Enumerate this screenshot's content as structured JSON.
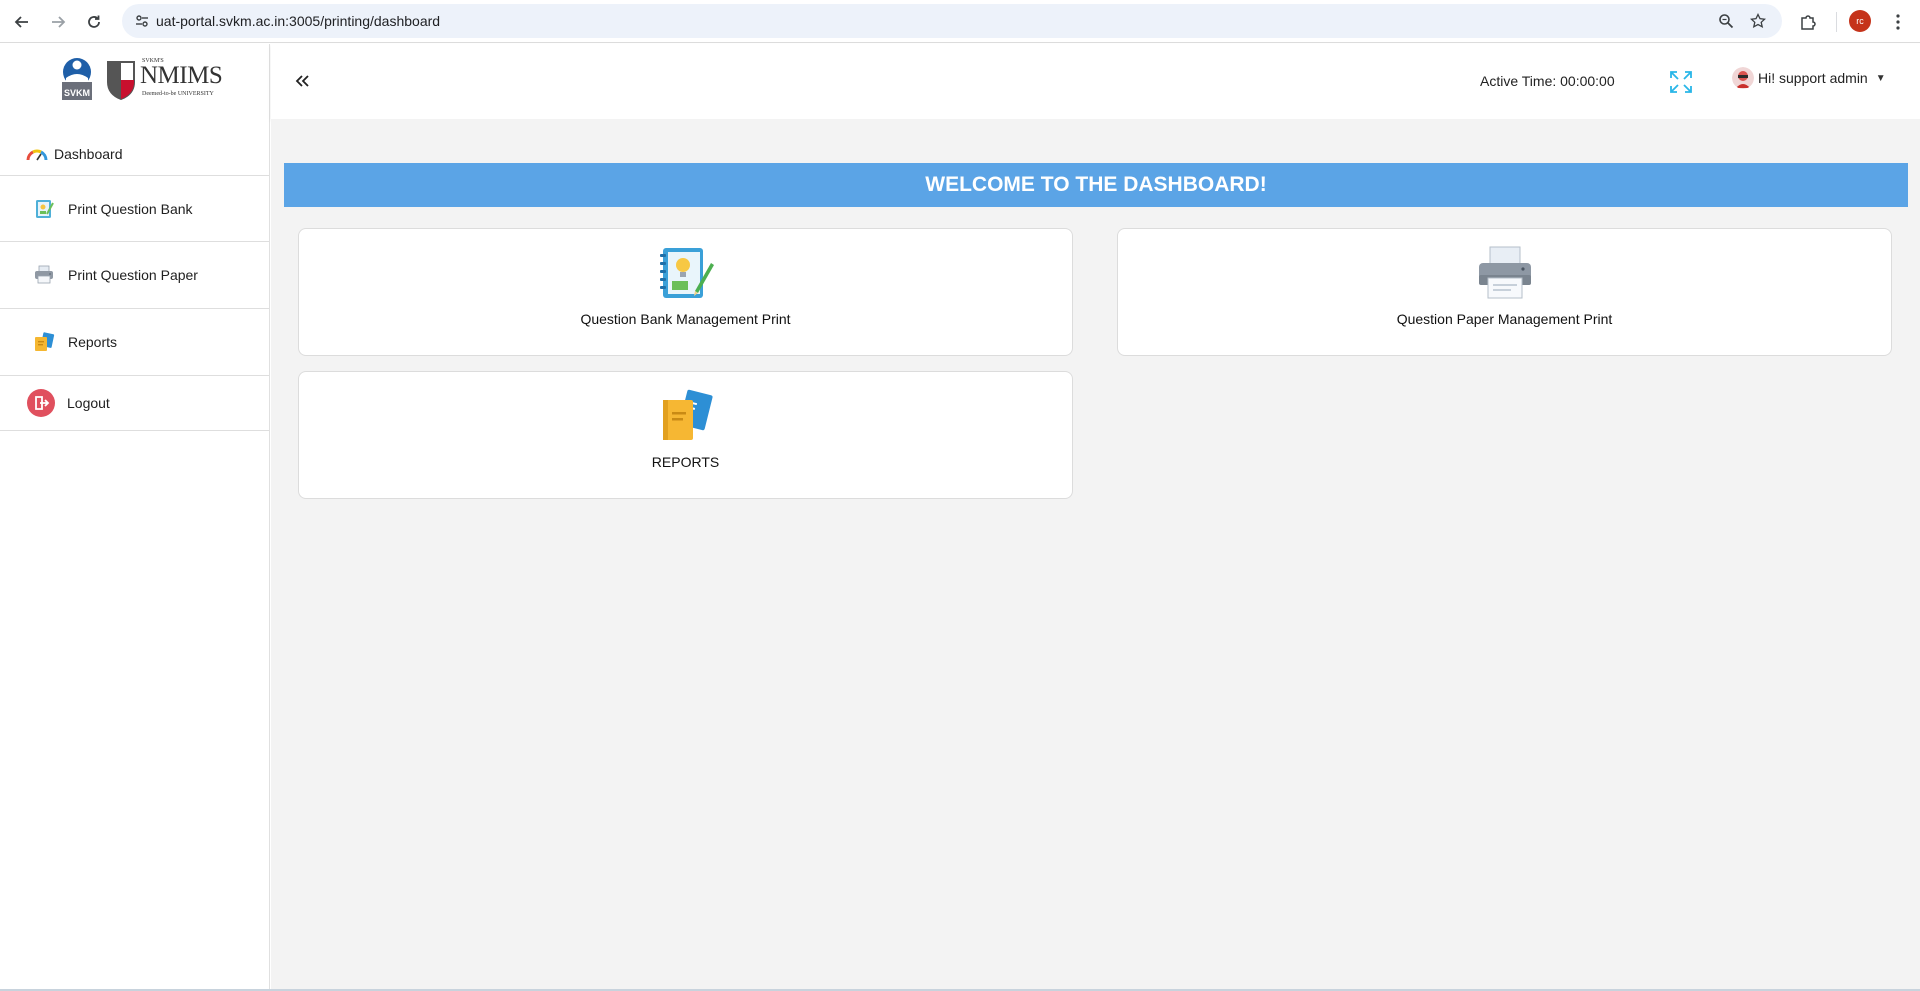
{
  "browser": {
    "url": "uat-portal.svkm.ac.in:3005/printing/dashboard",
    "profile_initials": "rc"
  },
  "sidebar": {
    "logo_svkm": "SVKM",
    "logo_nmims_top": "SVKM'S",
    "logo_nmims": "NMIMS",
    "logo_nmims_bottom": "Deemed-to-be UNIVERSITY",
    "items": [
      {
        "label": "Dashboard",
        "icon": "dashboard-gauge-icon"
      },
      {
        "label": "Print Question Bank",
        "icon": "question-bank-icon"
      },
      {
        "label": "Print Question Paper",
        "icon": "printer-icon"
      },
      {
        "label": "Reports",
        "icon": "reports-icon"
      },
      {
        "label": "Logout",
        "icon": "logout-icon"
      }
    ]
  },
  "header": {
    "active_time_label": "Active Time: 00:00:00",
    "user_greeting": "Hi! support admin"
  },
  "main": {
    "welcome_text": "WELCOME TO THE DASHBOARD!",
    "cards": [
      {
        "label": "Question Bank Management Print",
        "icon": "notebook-lightbulb-icon"
      },
      {
        "label": "Question Paper Management Print",
        "icon": "printer-icon"
      },
      {
        "label": "REPORTS",
        "icon": "reports-folders-icon"
      }
    ]
  },
  "colors": {
    "welcome_banner": "#5ba4e6",
    "page_background": "#f3f3f3",
    "fullscreen_icon": "#29b6e8",
    "profile_avatar": "#c5331a"
  }
}
